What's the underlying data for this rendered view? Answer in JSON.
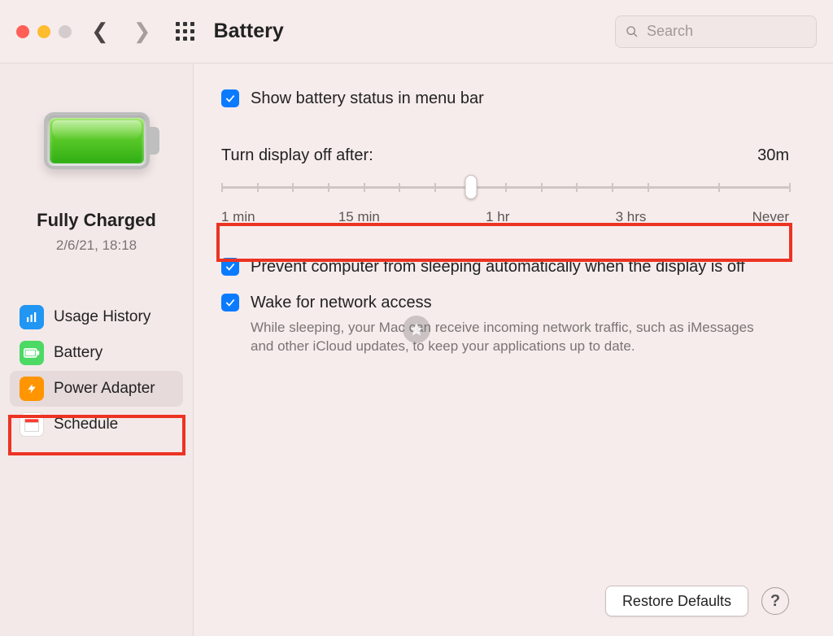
{
  "toolbar": {
    "title": "Battery",
    "search_placeholder": "Search"
  },
  "sidebar": {
    "status_title": "Fully Charged",
    "status_time": "2/6/21, 18:18",
    "items": [
      {
        "label": "Usage History"
      },
      {
        "label": "Battery"
      },
      {
        "label": "Power Adapter"
      },
      {
        "label": "Schedule"
      }
    ],
    "selected_index": 2
  },
  "main": {
    "show_menu_bar": "Show battery status in menu bar",
    "slider": {
      "title": "Turn display off after:",
      "value_label": "30m",
      "ticks": [
        "1 min",
        "15 min",
        "1 hr",
        "3 hrs",
        "Never"
      ]
    },
    "prevent_sleep": "Prevent computer from sleeping automatically when the display is off",
    "wake_network": "Wake for network access",
    "wake_desc": "While sleeping, your Mac can receive incoming network traffic, such as iMessages and other iCloud updates, to keep your applications up to date.",
    "restore_btn": "Restore Defaults",
    "help": "?"
  }
}
